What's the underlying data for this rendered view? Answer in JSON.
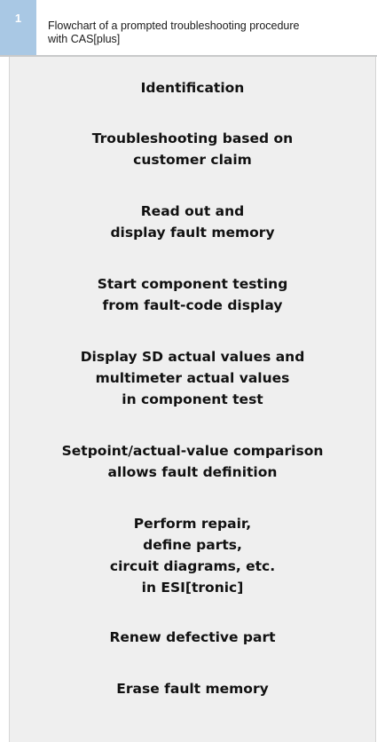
{
  "figure": {
    "number": "1",
    "caption_line1": "Flowchart of a prompted troubleshooting procedure",
    "caption_line2": "with CAS[plus]"
  },
  "steps": [
    {
      "lines": [
        "Identification"
      ]
    },
    {
      "lines": [
        "Troubleshooting based on",
        "customer claim"
      ]
    },
    {
      "lines": [
        "Read out and",
        "display fault memory"
      ]
    },
    {
      "lines": [
        "Start component testing",
        "from fault-code display"
      ]
    },
    {
      "lines": [
        "Display SD actual values and",
        "multimeter actual values",
        "in component test"
      ]
    },
    {
      "lines": [
        "Setpoint/actual-value comparison",
        "allows fault definition"
      ]
    },
    {
      "lines": [
        "Perform repair,",
        "define parts,",
        "circuit diagrams, etc.",
        "in ESI[tronic]"
      ]
    },
    {
      "lines": [
        "Renew defective part"
      ]
    },
    {
      "lines": [
        "Erase fault memory"
      ]
    }
  ],
  "colors": {
    "badge": "#a9c8e4",
    "panel": "#efefef",
    "text": "#111111"
  }
}
